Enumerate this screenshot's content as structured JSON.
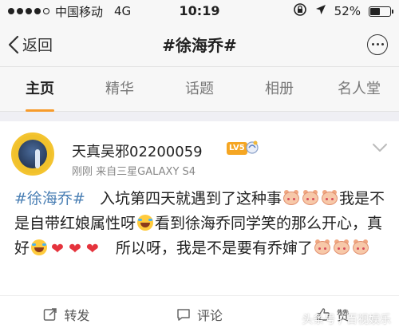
{
  "status_bar": {
    "carrier": "中国移动",
    "network": "4G",
    "time": "10:19",
    "battery_percent": "52%",
    "battery_level": 0.52
  },
  "nav": {
    "back_label": "返回",
    "title": "#徐海乔#"
  },
  "tabs": [
    {
      "label": "主页",
      "active": true
    },
    {
      "label": "精华",
      "active": false
    },
    {
      "label": "话题",
      "active": false
    },
    {
      "label": "相册",
      "active": false
    },
    {
      "label": "名人堂",
      "active": false
    }
  ],
  "post": {
    "username": "天真吴邪02200059",
    "level_badge": "LV5",
    "meta": "刚刚  来自三星GALAXY S4",
    "hashtag": "#徐海乔#",
    "text_1": "入坑第四天就遇到了这种事",
    "text_2": "我是不是自带红娘属性呀",
    "text_3": "看到徐海乔同学笑的那么开心，真好",
    "text_4": "所以呀，我是不是要有乔婶了"
  },
  "actions": {
    "repost_label": "转发",
    "comment_label": "评论",
    "like_label": "赞"
  },
  "watermark": "头条号 / 百视娱乐",
  "colors": {
    "accent": "#f79b2b",
    "link": "#4a7fb4",
    "heart": "#e5333c"
  }
}
